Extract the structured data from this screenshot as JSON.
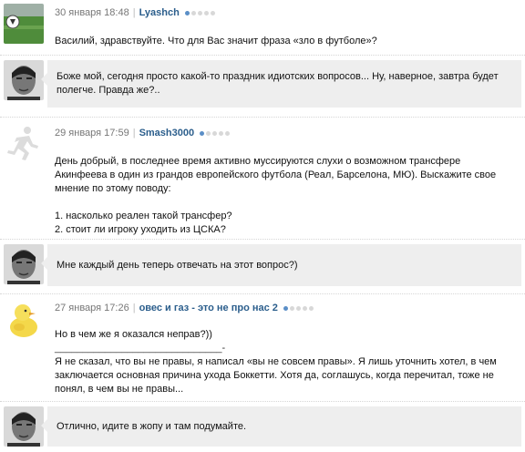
{
  "entries": [
    {
      "question": {
        "date": "30 января 18:48",
        "separator": "|",
        "user": "Lyashch",
        "rating": 1,
        "text": "Василий, здравствуйте. Что для Вас значит фраза «зло в футболе»?"
      },
      "answer": {
        "lines": [
          "Боже мой, сегодня просто какой-то праздник идиотских вопросов... Ну, наверное, завтра будет",
          "полегче. Правда же?.."
        ]
      }
    },
    {
      "question": {
        "date": "29 января 17:59",
        "separator": "|",
        "user": "Smash3000",
        "rating": 1,
        "lines": [
          "День добрый, в последнее время активно муссируются слухи о возможном трансфере",
          "Акинфеева в один из грандов европейского футбола (Реал, Барселона, МЮ). Выскажите свое",
          "мнение по этому поводу:",
          "",
          "1. насколько реален такой трансфер?",
          "2. стоит ли игроку уходить из ЦСКА?"
        ]
      },
      "answer": {
        "lines": [
          "Мне каждый день теперь отвечать на этот вопрос?)"
        ]
      }
    },
    {
      "question": {
        "date": "27 января 17:26",
        "separator": "|",
        "user": "овес и газ - это не про нас 2",
        "rating": 1,
        "lines": [
          "Но в чем же я оказался неправ?))",
          "______________________________-",
          "Я не сказал, что вы не правы, я написал «вы не совсем правы». Я лишь уточнить хотел, в чем",
          "заключается основная причина ухода Боккетти. Хотя да, соглашусь, когда перечитал, тоже не",
          "понял, в чем вы не правы..."
        ]
      },
      "answer": {
        "lines": [
          "Отлично, идите в жопу и там подумайте."
        ]
      }
    }
  ],
  "colors": {
    "username": "#2b5e8c",
    "date": "#777777",
    "answer_bg": "#eeeeee",
    "rating_on": "#5b8fc7",
    "rating_off": "#d8d8d8"
  },
  "icons": {
    "user1_avatar": "football-field-avatar",
    "user2_avatar": "runner-silhouette-avatar",
    "user3_avatar": "yellow-duckling-avatar",
    "answerer_avatar": "bw-portrait-avatar"
  }
}
